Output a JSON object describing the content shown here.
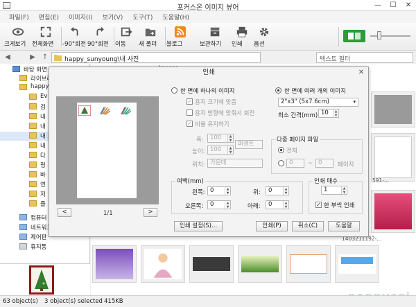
{
  "window": {
    "title": "포커스온 이미지 뷰어",
    "min": "—",
    "max": "☐",
    "close": "✕"
  },
  "menu": [
    "파일(F)",
    "편집(E)",
    "이미지(I)",
    "보기(V)",
    "도구(T)",
    "도움말(H)"
  ],
  "toolbar": {
    "view": "크게보기",
    "fullscreen": "전체화면",
    "rot_left": "-90°회전",
    "rot_right": "90°회전",
    "move": "이동",
    "new_folder": "새 폴더",
    "blog": "블로그",
    "saveas": "보관하기",
    "print": "인쇄",
    "options": "옵션"
  },
  "address": {
    "path": "happy_sunyoung\\내 사진",
    "filter": "텍스트 필터",
    "back": "◀",
    "forward": "▶",
    "up": "↑"
  },
  "tree": [
    {
      "label": "바탕 화면",
      "indent": 0
    },
    {
      "label": "라이브러리",
      "indent": 1
    },
    {
      "label": "happy",
      "indent": 1
    },
    {
      "label": "Ev",
      "indent": 2
    },
    {
      "label": "검",
      "indent": 2
    },
    {
      "label": "내",
      "indent": 2
    },
    {
      "label": "내",
      "indent": 2
    },
    {
      "label": "내",
      "indent": 2
    },
    {
      "label": "내",
      "indent": 2
    },
    {
      "label": "다",
      "indent": 2
    },
    {
      "label": "링",
      "indent": 2
    },
    {
      "label": "바",
      "indent": 2
    },
    {
      "label": "연",
      "indent": 2
    },
    {
      "label": "저",
      "indent": 2
    },
    {
      "label": "즐",
      "indent": 2
    },
    {
      "label": "컴퓨터",
      "indent": 1
    },
    {
      "label": "네트워크",
      "indent": 1
    },
    {
      "label": "제어판",
      "indent": 1
    },
    {
      "label": "휴지통",
      "indent": 1
    }
  ],
  "gallery_labels": [
    "Images",
    "591-...",
    "1403211192-..."
  ],
  "status": {
    "objects": "63 object(s)",
    "selected": "3 object(s) selected",
    "size": "415KB"
  },
  "watermark": "nappycgi",
  "dialog": {
    "title": "인쇄",
    "close": "✕",
    "single_mode": "한 면에 하나의 이미지",
    "fit_paper": "용지 크기에 맞춤",
    "rotate_fit": "용지 방향에 맞춰서 회전",
    "keep_ratio": "비율 유지하기",
    "width_label": "폭:",
    "width_value": "100",
    "height_label": "높이:",
    "height_value": "100",
    "unit": "퍼센트",
    "position_label": "위치:",
    "position_value": "가운데",
    "multi_mode": "한 면에 여러 개의 이미지",
    "layout": "2\"x3\" (5x7.6cm)",
    "min_gap_label": "최소 간격(mm):",
    "min_gap_value": "10",
    "multipage_group": "다중 페이지 파일",
    "all": "전체",
    "range_from": "0",
    "range_sep": "~",
    "range_to": "0",
    "pages": "페이지",
    "margin_group": "여백(mm)",
    "left_label": "왼쪽:",
    "left_value": "0",
    "top_label": "위:",
    "top_value": "0",
    "right_label": "오른쪽:",
    "right_value": "0",
    "bottom_label": "아래:",
    "bottom_value": "0",
    "copies_group": "인쇄 매수",
    "copies_value": "1",
    "one_each": "한 부씩 인쇄",
    "page_indicator": "1/1",
    "prev": "<",
    "next": ">",
    "print_settings": "인쇄 설정(S)...",
    "print_btn": "인쇄(P)",
    "cancel_btn": "취소(C)",
    "help_btn": "도움말"
  }
}
